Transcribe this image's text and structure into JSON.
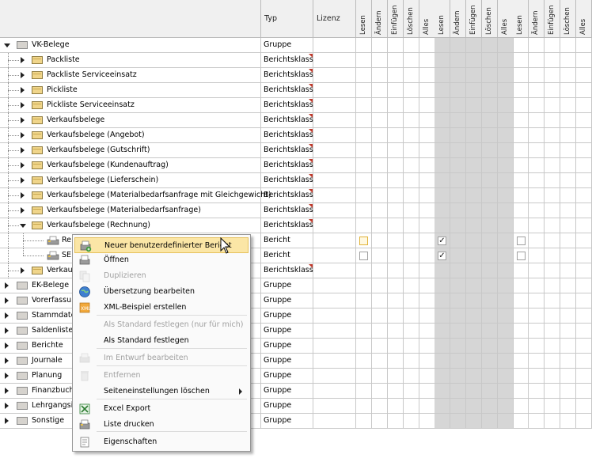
{
  "columns": {
    "typ": "Typ",
    "lizenz": "Lizenz",
    "group1": [
      "Lesen",
      "Ändern",
      "Einfügen",
      "Löschen",
      "Alles"
    ],
    "group2": [
      "Lesen",
      "Ändern",
      "Einfügen",
      "Löschen",
      "Alles"
    ],
    "group3": [
      "Lesen",
      "Ändern",
      "Einfügen",
      "Löschen",
      "Alles"
    ]
  },
  "rows": [
    {
      "label": "VK-Belege",
      "typ": "Gruppe"
    },
    {
      "label": "Packliste",
      "typ": "Berichtsklass"
    },
    {
      "label": "Packliste Serviceeinsatz",
      "typ": "Berichtsklass"
    },
    {
      "label": "Pickliste",
      "typ": "Berichtsklass"
    },
    {
      "label": "Pickliste Serviceeinsatz",
      "typ": "Berichtsklass"
    },
    {
      "label": "Verkaufsbelege",
      "typ": "Berichtsklass"
    },
    {
      "label": "Verkaufsbelege (Angebot)",
      "typ": "Berichtsklass"
    },
    {
      "label": "Verkaufsbelege (Gutschrift)",
      "typ": "Berichtsklass"
    },
    {
      "label": "Verkaufsbelege (Kundenauftrag)",
      "typ": "Berichtsklass"
    },
    {
      "label": "Verkaufsbelege (Lieferschein)",
      "typ": "Berichtsklass"
    },
    {
      "label": "Verkaufsbelege (Materialbedarfsanfrage mit Gleichgewicht)",
      "typ": "Berichtsklass"
    },
    {
      "label": "Verkaufsbelege (Materialbedarfsanfrage)",
      "typ": "Berichtsklass"
    },
    {
      "label": "Verkaufsbelege (Rechnung)",
      "typ": "Berichtsklass"
    },
    {
      "label": "Re",
      "typ": "Bericht"
    },
    {
      "label": "SE",
      "typ": "Bericht"
    },
    {
      "label": "Verkau",
      "typ": "Berichtsklass"
    },
    {
      "label": "EK-Belege",
      "typ": "Gruppe"
    },
    {
      "label": "Vorerfassu",
      "typ": "Gruppe"
    },
    {
      "label": "Stammdate",
      "typ": "Gruppe"
    },
    {
      "label": "Saldenlister",
      "typ": "Gruppe"
    },
    {
      "label": "Berichte",
      "typ": "Gruppe"
    },
    {
      "label": "Journale",
      "typ": "Gruppe"
    },
    {
      "label": "Planung",
      "typ": "Gruppe"
    },
    {
      "label": "Finanzbuch",
      "typ": "Gruppe"
    },
    {
      "label": "Lehrgangsi",
      "typ": "Gruppe"
    },
    {
      "label": "Sonstige",
      "typ": "Gruppe"
    }
  ],
  "checks": {
    "check_mark": "✓"
  },
  "context_menu": {
    "items": [
      {
        "label": "Neuer benutzerdefinierter Bericht",
        "icon": "new-report-icon",
        "enabled": true,
        "highlighted": true
      },
      {
        "label": "Öffnen",
        "icon": "open-icon",
        "enabled": true
      },
      {
        "label": "Duplizieren",
        "icon": "duplicate-icon",
        "enabled": false
      },
      {
        "label": "Übersetzung bearbeiten",
        "icon": "globe-icon",
        "enabled": true
      },
      {
        "label": "XML-Beispiel erstellen",
        "icon": "xml-icon",
        "enabled": true
      },
      {
        "label": "Als Standard festlegen (nur für mich)",
        "icon": "",
        "enabled": false
      },
      {
        "label": "Als Standard festlegen",
        "icon": "",
        "enabled": true
      },
      {
        "label": "Im Entwurf bearbeiten",
        "icon": "design-icon",
        "enabled": false
      },
      {
        "label": "Entfernen",
        "icon": "trash-icon",
        "enabled": false
      },
      {
        "label": "Seiteneinstellungen löschen",
        "icon": "",
        "enabled": true,
        "submenu": true
      },
      {
        "label": "Excel Export",
        "icon": "excel-icon",
        "enabled": true
      },
      {
        "label": "Liste drucken",
        "icon": "print-icon",
        "enabled": true
      },
      {
        "label": "Eigenschaften",
        "icon": "properties-icon",
        "enabled": true
      }
    ]
  },
  "colors": {
    "highlight": "#fbe6a6",
    "grey_col": "#d6d6d6",
    "red_marker": "#c0392b"
  }
}
